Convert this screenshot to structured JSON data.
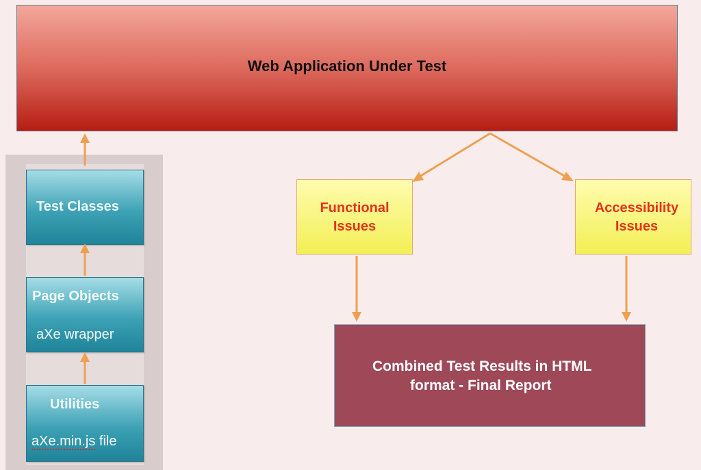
{
  "top": {
    "title": "Web Application Under Test"
  },
  "left_stack": {
    "test_classes": "Test Classes",
    "page_objects": "Page Objects",
    "axe_wrapper": "aXe wrapper",
    "utilities": "Utilities",
    "axe_file_name": "aXe.min.js",
    "axe_file_suffix": " file"
  },
  "issues": {
    "functional_line1": "Functional",
    "functional_line2": "Issues",
    "accessibility_line1": "Accessibility",
    "accessibility_line2": "Issues"
  },
  "report": {
    "line1": "Combined Test Results in HTML",
    "line2": "format - Final Report"
  },
  "colors": {
    "arrow": "#eea050",
    "top_box_dark": "#b61d14",
    "teal": "#3ea2b6",
    "yellow": "#f3ef55",
    "issue_text": "#e8301a",
    "report_box": "#9e4858"
  }
}
